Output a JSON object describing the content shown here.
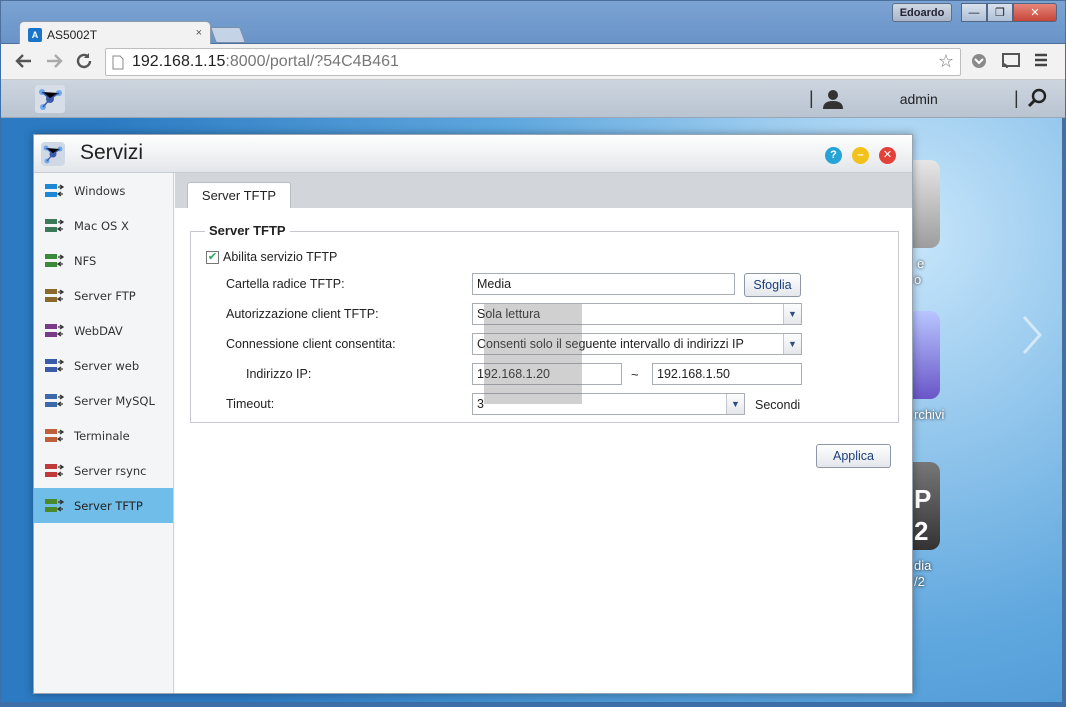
{
  "browser": {
    "tab_title": "AS5002T",
    "tab_favicon": "A",
    "tab_close": "×",
    "user_badge": "Edoardo",
    "window_buttons": {
      "minimize": "—",
      "maximize": "❐",
      "close": "✕"
    },
    "url_host": "192.168.1.15",
    "url_rest": ":8000/portal/?54C4B461",
    "icons": {
      "back": "back-arrow-icon",
      "forward": "forward-arrow-icon",
      "reload": "reload-icon",
      "star": "star-icon",
      "menu": "hamburger-menu-icon"
    }
  },
  "appbar": {
    "user": "admin",
    "separator": "|"
  },
  "desktop": {
    "labels": [
      "e",
      "o",
      "rchivi",
      "P",
      "2",
      "dia",
      "/2"
    ]
  },
  "window": {
    "title": "Servizi",
    "controls": {
      "help": "?",
      "minimize": "–",
      "close": "✕"
    },
    "sidebar": [
      {
        "label": "Windows",
        "icon": "windows-icon",
        "color": "#1e88d6"
      },
      {
        "label": "Mac OS X",
        "icon": "mac-x-icon",
        "color": "#3a7a5a"
      },
      {
        "label": "NFS",
        "icon": "nfs-icon",
        "color": "#3a8a3a"
      },
      {
        "label": "Server FTP",
        "icon": "ftp-icon",
        "color": "#8a6a2a"
      },
      {
        "label": "WebDAV",
        "icon": "webdav-icon",
        "color": "#7a3a8a"
      },
      {
        "label": "Server web",
        "icon": "web-server-icon",
        "color": "#3a5aaa"
      },
      {
        "label": "Server MySQL",
        "icon": "mysql-icon",
        "color": "#3a6aaa"
      },
      {
        "label": "Terminale",
        "icon": "terminal-icon",
        "color": "#c0603a"
      },
      {
        "label": "Server rsync",
        "icon": "rsync-icon",
        "color": "#c03a3a"
      },
      {
        "label": "Server TFTP",
        "icon": "tftp-icon",
        "color": "#4a8a2a"
      }
    ],
    "active_index": 9,
    "tab": "Server TFTP",
    "form": {
      "legend": "Server TFTP",
      "enable_label": "Abilita servizio TFTP",
      "enable_checked": true,
      "root_label": "Cartella radice TFTP:",
      "root_value": "Media",
      "browse_button": "Sfoglia",
      "auth_label": "Autorizzazione client TFTP:",
      "auth_value": "Sola lettura",
      "conn_label": "Connessione client consentita:",
      "conn_value": "Consenti solo il seguente intervallo di indirizzi IP",
      "ip_label": "Indirizzo IP:",
      "ip_from": "192.168.1.20",
      "ip_separator": "~",
      "ip_to": "192.168.1.50",
      "timeout_label": "Timeout:",
      "timeout_value": "3",
      "timeout_unit": "Secondi",
      "apply_button": "Applica"
    }
  }
}
